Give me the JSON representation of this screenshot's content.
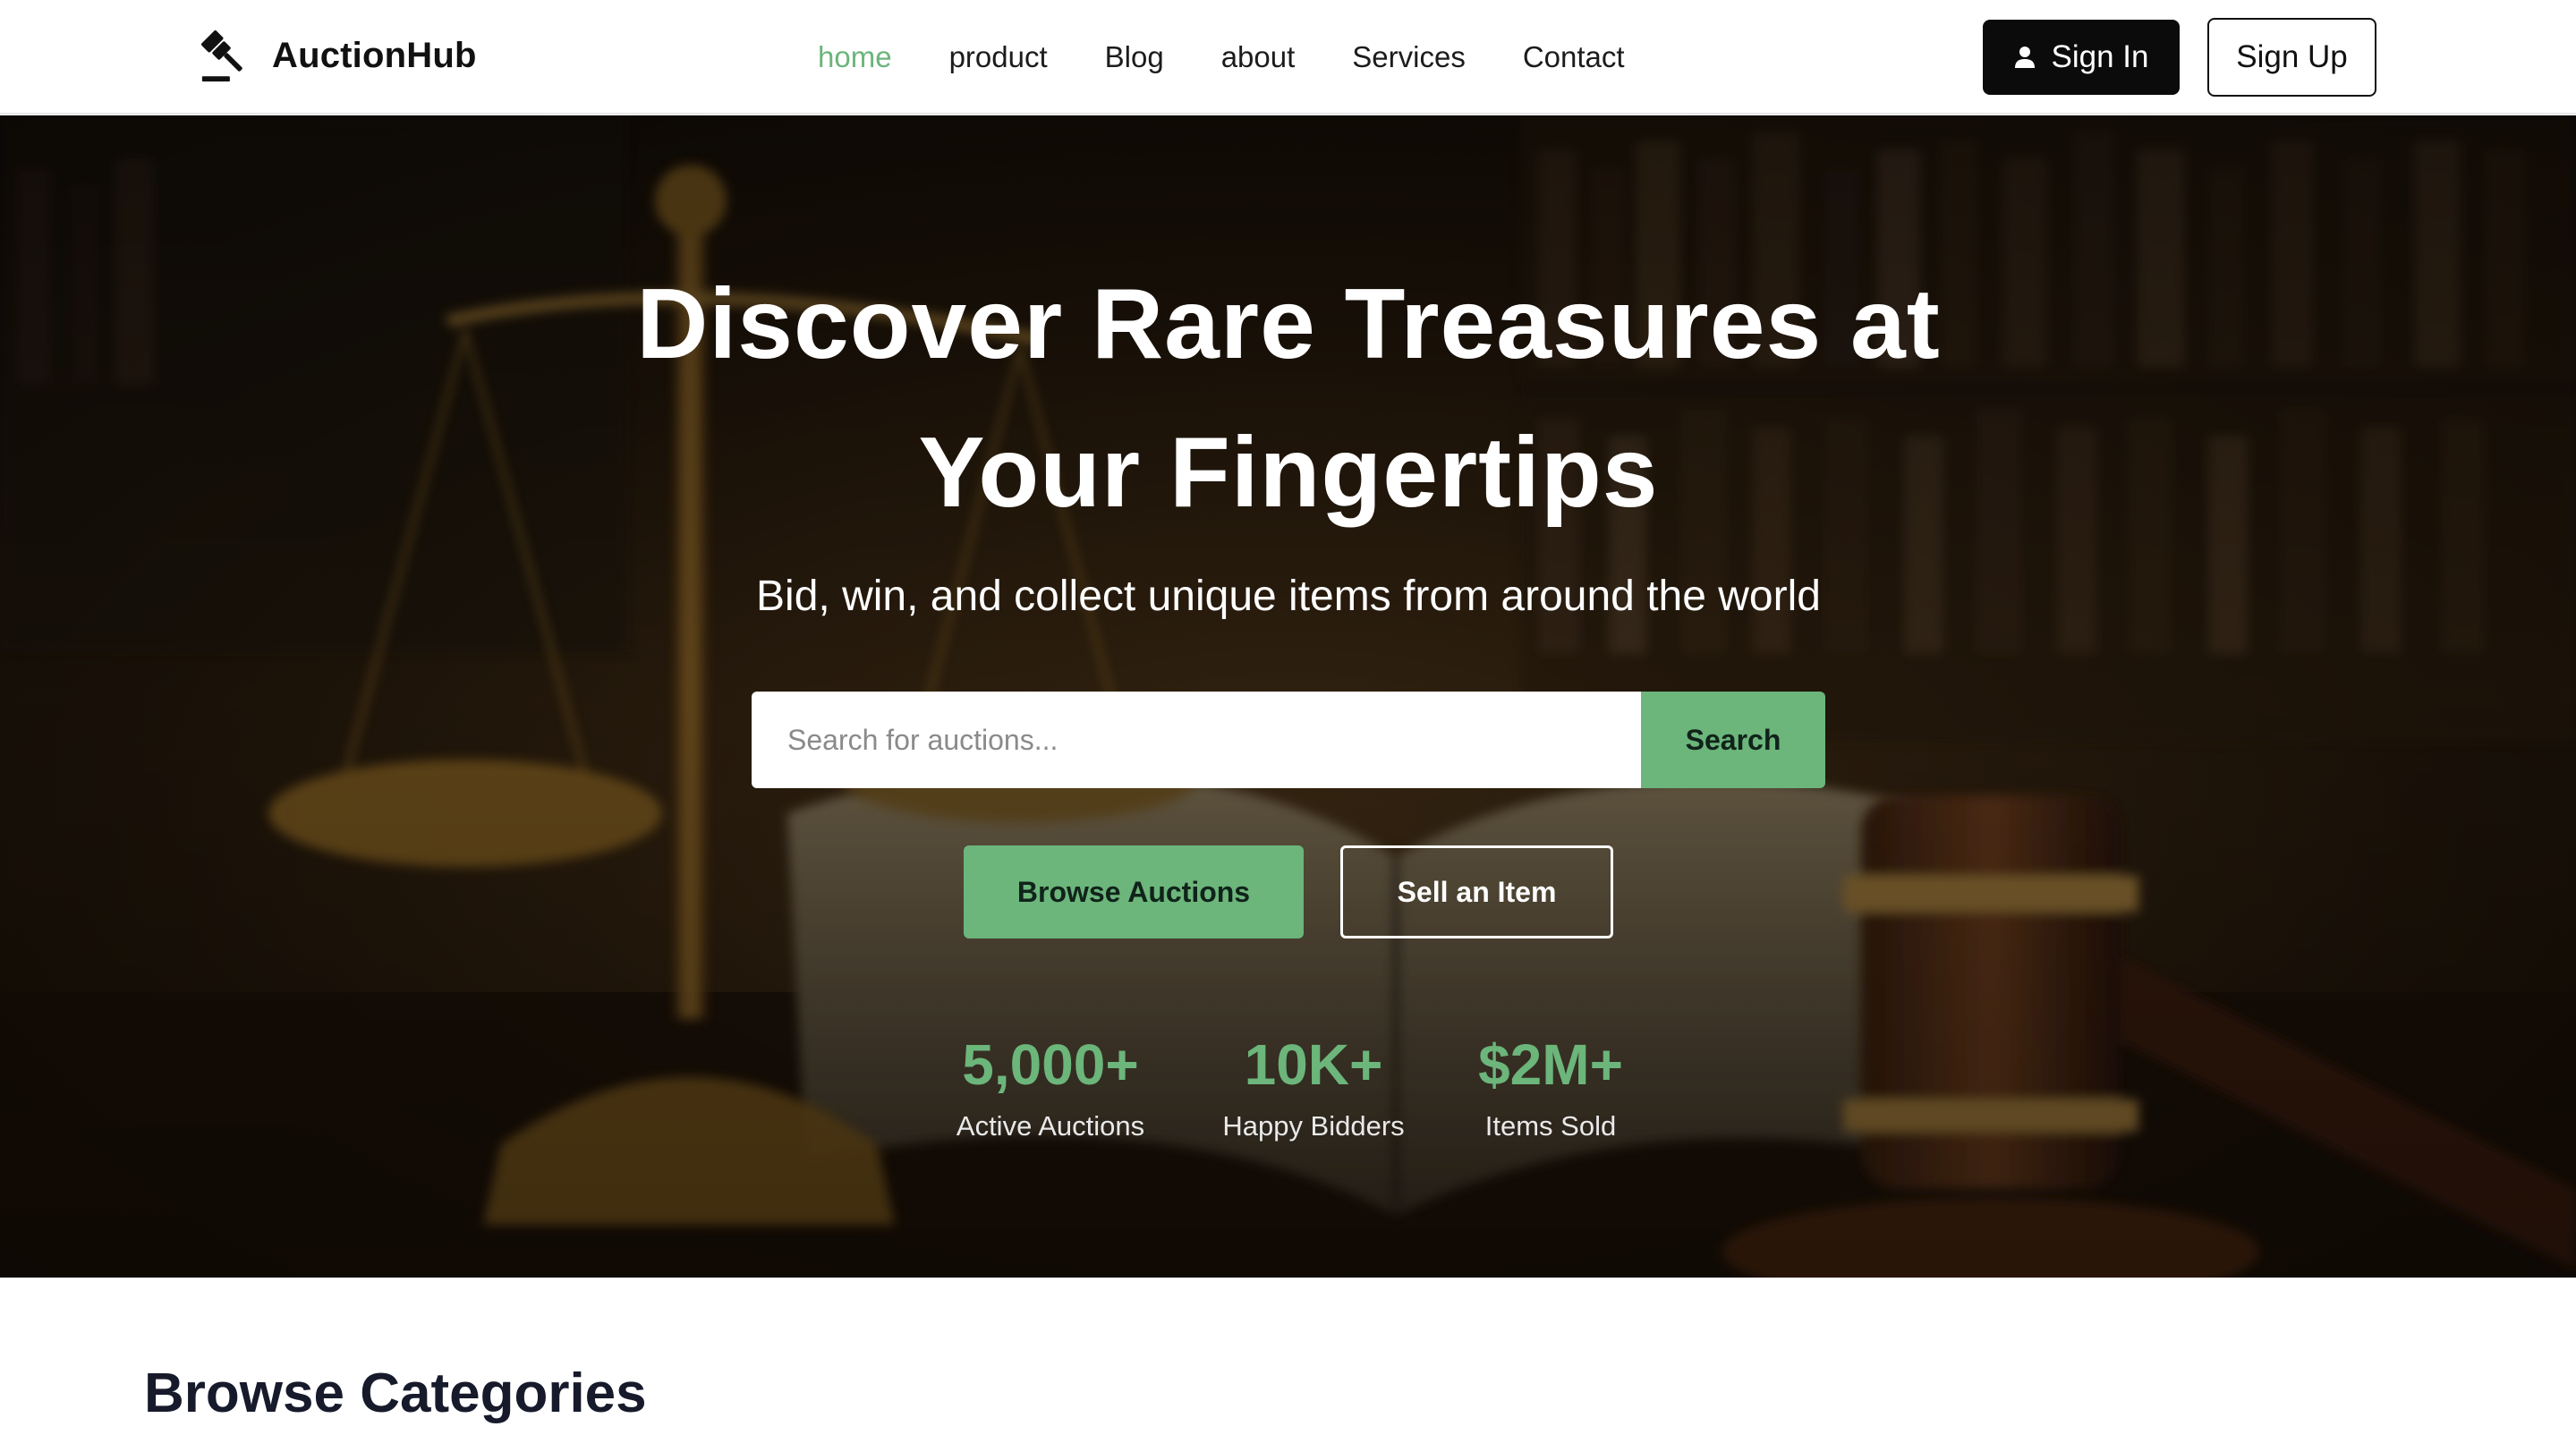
{
  "brand": {
    "name": "AuctionHub",
    "logo_icon": "gavel-icon"
  },
  "nav": {
    "links": [
      {
        "label": "home",
        "active": true
      },
      {
        "label": "product",
        "active": false
      },
      {
        "label": "Blog",
        "active": false
      },
      {
        "label": "about",
        "active": false
      },
      {
        "label": "Services",
        "active": false
      },
      {
        "label": "Contact",
        "active": false
      }
    ],
    "sign_in": {
      "label": "Sign In",
      "icon": "user-icon"
    },
    "sign_up": {
      "label": "Sign Up"
    }
  },
  "hero": {
    "title_line1": "Discover Rare Treasures at",
    "title_line2": "Your Fingertips",
    "subtitle": "Bid, win, and collect unique items from around the world",
    "search": {
      "placeholder": "Search for auctions...",
      "value": "",
      "button_label": "Search"
    },
    "primary_cta": "Browse Auctions",
    "secondary_cta": "Sell an Item",
    "stats": [
      {
        "value": "5,000+",
        "label": "Active Auctions"
      },
      {
        "value": "10K+",
        "label": "Happy Bidders"
      },
      {
        "value": "$2M+",
        "label": "Items Sold"
      }
    ]
  },
  "categories": {
    "title": "Browse Categories"
  },
  "colors": {
    "accent": "#6cb57b",
    "dark": "#0b0b0b",
    "heading": "#161a2b",
    "white": "#ffffff"
  }
}
